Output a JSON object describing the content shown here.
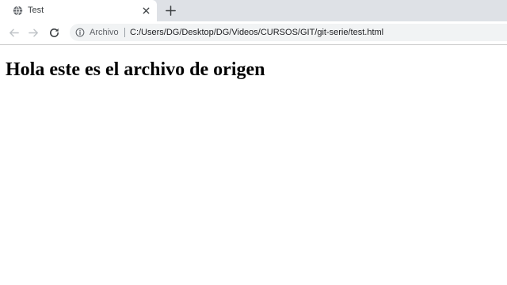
{
  "tab": {
    "title": "Test",
    "favicon": "globe-icon",
    "close_icon": "close-icon"
  },
  "new_tab_icon": "plus-icon",
  "toolbar": {
    "back_icon": "arrow-left-icon",
    "forward_icon": "arrow-right-icon",
    "reload_icon": "reload-icon",
    "info_icon": "info-icon",
    "chip_label": "Archivo",
    "url": "C:/Users/DG/Desktop/DG/Videos/CURSOS/GIT/git-serie/test.html"
  },
  "page": {
    "heading": "Hola este es el archivo de origen"
  },
  "colors": {
    "tabstrip_bg": "#dee1e6",
    "omnibox_bg": "#f1f3f4",
    "icon_gray": "#5f6368",
    "disabled_gray": "#c0c4c8"
  }
}
